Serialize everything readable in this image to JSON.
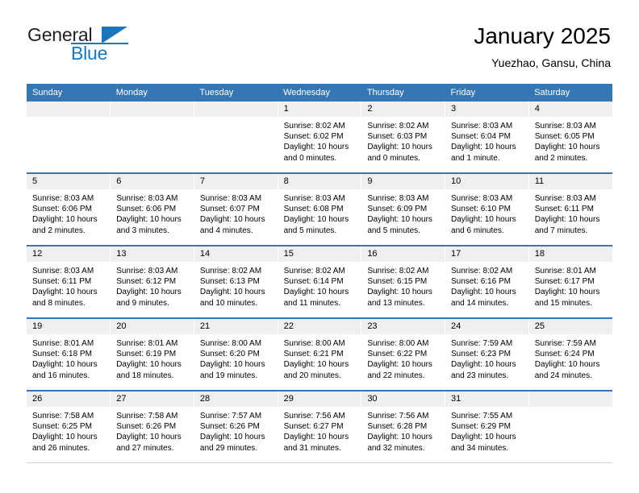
{
  "logo": {
    "word1": "General",
    "word2": "Blue",
    "mark": "triangle-mark",
    "brand_color": "#1b75bb"
  },
  "header": {
    "title": "January 2025",
    "subtitle": "Yuezhao, Gansu, China"
  },
  "calendar": {
    "header_bg": "#3576b5",
    "daynum_bg": "#efefef",
    "weekdays": [
      "Sunday",
      "Monday",
      "Tuesday",
      "Wednesday",
      "Thursday",
      "Friday",
      "Saturday"
    ],
    "weeks": [
      [
        {
          "day": "",
          "empty": true
        },
        {
          "day": "",
          "empty": true
        },
        {
          "day": "",
          "empty": true
        },
        {
          "day": "1",
          "sunrise": "Sunrise: 8:02 AM",
          "sunset": "Sunset: 6:02 PM",
          "daylight": "Daylight: 10 hours and 0 minutes."
        },
        {
          "day": "2",
          "sunrise": "Sunrise: 8:02 AM",
          "sunset": "Sunset: 6:03 PM",
          "daylight": "Daylight: 10 hours and 0 minutes."
        },
        {
          "day": "3",
          "sunrise": "Sunrise: 8:03 AM",
          "sunset": "Sunset: 6:04 PM",
          "daylight": "Daylight: 10 hours and 1 minute."
        },
        {
          "day": "4",
          "sunrise": "Sunrise: 8:03 AM",
          "sunset": "Sunset: 6:05 PM",
          "daylight": "Daylight: 10 hours and 2 minutes."
        }
      ],
      [
        {
          "day": "5",
          "sunrise": "Sunrise: 8:03 AM",
          "sunset": "Sunset: 6:06 PM",
          "daylight": "Daylight: 10 hours and 2 minutes."
        },
        {
          "day": "6",
          "sunrise": "Sunrise: 8:03 AM",
          "sunset": "Sunset: 6:06 PM",
          "daylight": "Daylight: 10 hours and 3 minutes."
        },
        {
          "day": "7",
          "sunrise": "Sunrise: 8:03 AM",
          "sunset": "Sunset: 6:07 PM",
          "daylight": "Daylight: 10 hours and 4 minutes."
        },
        {
          "day": "8",
          "sunrise": "Sunrise: 8:03 AM",
          "sunset": "Sunset: 6:08 PM",
          "daylight": "Daylight: 10 hours and 5 minutes."
        },
        {
          "day": "9",
          "sunrise": "Sunrise: 8:03 AM",
          "sunset": "Sunset: 6:09 PM",
          "daylight": "Daylight: 10 hours and 5 minutes."
        },
        {
          "day": "10",
          "sunrise": "Sunrise: 8:03 AM",
          "sunset": "Sunset: 6:10 PM",
          "daylight": "Daylight: 10 hours and 6 minutes."
        },
        {
          "day": "11",
          "sunrise": "Sunrise: 8:03 AM",
          "sunset": "Sunset: 6:11 PM",
          "daylight": "Daylight: 10 hours and 7 minutes."
        }
      ],
      [
        {
          "day": "12",
          "sunrise": "Sunrise: 8:03 AM",
          "sunset": "Sunset: 6:11 PM",
          "daylight": "Daylight: 10 hours and 8 minutes."
        },
        {
          "day": "13",
          "sunrise": "Sunrise: 8:03 AM",
          "sunset": "Sunset: 6:12 PM",
          "daylight": "Daylight: 10 hours and 9 minutes."
        },
        {
          "day": "14",
          "sunrise": "Sunrise: 8:02 AM",
          "sunset": "Sunset: 6:13 PM",
          "daylight": "Daylight: 10 hours and 10 minutes."
        },
        {
          "day": "15",
          "sunrise": "Sunrise: 8:02 AM",
          "sunset": "Sunset: 6:14 PM",
          "daylight": "Daylight: 10 hours and 11 minutes."
        },
        {
          "day": "16",
          "sunrise": "Sunrise: 8:02 AM",
          "sunset": "Sunset: 6:15 PM",
          "daylight": "Daylight: 10 hours and 13 minutes."
        },
        {
          "day": "17",
          "sunrise": "Sunrise: 8:02 AM",
          "sunset": "Sunset: 6:16 PM",
          "daylight": "Daylight: 10 hours and 14 minutes."
        },
        {
          "day": "18",
          "sunrise": "Sunrise: 8:01 AM",
          "sunset": "Sunset: 6:17 PM",
          "daylight": "Daylight: 10 hours and 15 minutes."
        }
      ],
      [
        {
          "day": "19",
          "sunrise": "Sunrise: 8:01 AM",
          "sunset": "Sunset: 6:18 PM",
          "daylight": "Daylight: 10 hours and 16 minutes."
        },
        {
          "day": "20",
          "sunrise": "Sunrise: 8:01 AM",
          "sunset": "Sunset: 6:19 PM",
          "daylight": "Daylight: 10 hours and 18 minutes."
        },
        {
          "day": "21",
          "sunrise": "Sunrise: 8:00 AM",
          "sunset": "Sunset: 6:20 PM",
          "daylight": "Daylight: 10 hours and 19 minutes."
        },
        {
          "day": "22",
          "sunrise": "Sunrise: 8:00 AM",
          "sunset": "Sunset: 6:21 PM",
          "daylight": "Daylight: 10 hours and 20 minutes."
        },
        {
          "day": "23",
          "sunrise": "Sunrise: 8:00 AM",
          "sunset": "Sunset: 6:22 PM",
          "daylight": "Daylight: 10 hours and 22 minutes."
        },
        {
          "day": "24",
          "sunrise": "Sunrise: 7:59 AM",
          "sunset": "Sunset: 6:23 PM",
          "daylight": "Daylight: 10 hours and 23 minutes."
        },
        {
          "day": "25",
          "sunrise": "Sunrise: 7:59 AM",
          "sunset": "Sunset: 6:24 PM",
          "daylight": "Daylight: 10 hours and 24 minutes."
        }
      ],
      [
        {
          "day": "26",
          "sunrise": "Sunrise: 7:58 AM",
          "sunset": "Sunset: 6:25 PM",
          "daylight": "Daylight: 10 hours and 26 minutes."
        },
        {
          "day": "27",
          "sunrise": "Sunrise: 7:58 AM",
          "sunset": "Sunset: 6:26 PM",
          "daylight": "Daylight: 10 hours and 27 minutes."
        },
        {
          "day": "28",
          "sunrise": "Sunrise: 7:57 AM",
          "sunset": "Sunset: 6:26 PM",
          "daylight": "Daylight: 10 hours and 29 minutes."
        },
        {
          "day": "29",
          "sunrise": "Sunrise: 7:56 AM",
          "sunset": "Sunset: 6:27 PM",
          "daylight": "Daylight: 10 hours and 31 minutes."
        },
        {
          "day": "30",
          "sunrise": "Sunrise: 7:56 AM",
          "sunset": "Sunset: 6:28 PM",
          "daylight": "Daylight: 10 hours and 32 minutes."
        },
        {
          "day": "31",
          "sunrise": "Sunrise: 7:55 AM",
          "sunset": "Sunset: 6:29 PM",
          "daylight": "Daylight: 10 hours and 34 minutes."
        },
        {
          "day": "",
          "empty": true
        }
      ]
    ]
  }
}
